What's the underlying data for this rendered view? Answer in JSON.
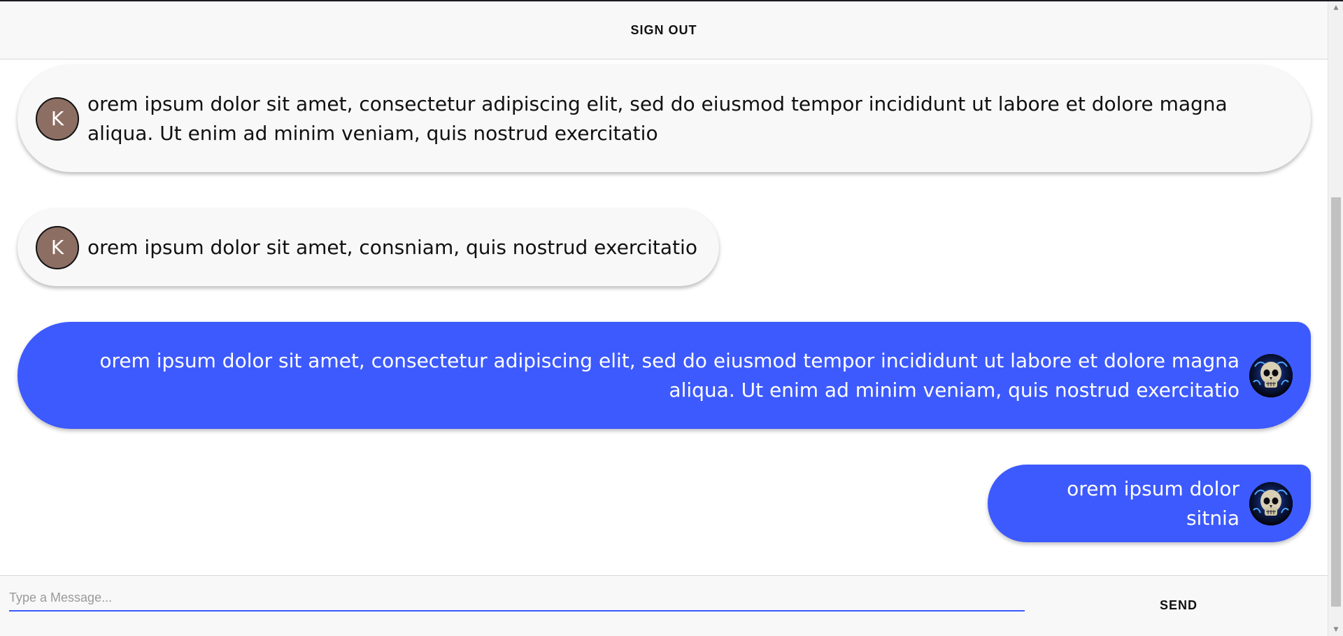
{
  "header": {
    "sign_out_label": "SIGN OUT"
  },
  "messages": [
    {
      "direction": "received",
      "avatar_letter": "K",
      "avatar_color": "#8d6e63",
      "text": "orem ipsum dolor sit amet, consectetur adipiscing elit, sed do eiusmod tempor incididunt ut labore et dolore magna aliqua. Ut enim ad minim veniam, quis nostrud exercitatio"
    },
    {
      "direction": "received",
      "avatar_letter": "K",
      "avatar_color": "#8d6e63",
      "text": "orem ipsum dolor sit amet, consniam, quis nostrud exercitatio"
    },
    {
      "direction": "sent",
      "avatar_icon": "skull-avatar-icon",
      "bubble_color": "#3d5afe",
      "text": "orem ipsum dolor sit amet, consectetur adipiscing elit, sed do eiusmod tempor incididunt ut labore et dolore magna aliqua. Ut enim ad minim veniam, quis nostrud exercitatio"
    },
    {
      "direction": "sent",
      "avatar_icon": "skull-avatar-icon",
      "bubble_color": "#3d5afe",
      "text": "orem ipsum dolor sitnia"
    }
  ],
  "composer": {
    "placeholder": "Type a Message...",
    "value": "",
    "send_label": "SEND",
    "accent_color": "#3d5afe"
  }
}
